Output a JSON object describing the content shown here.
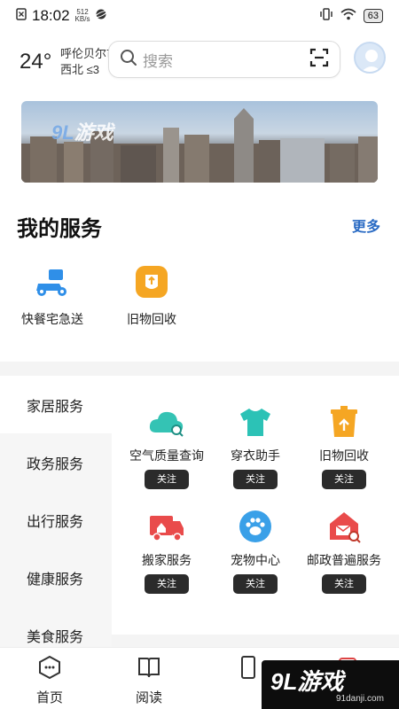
{
  "status_bar": {
    "time": "18:02",
    "net_speed_value": "512",
    "net_speed_unit": "KB/s",
    "battery": "63"
  },
  "header": {
    "temperature": "24°",
    "city": "呼伦贝尔市",
    "wind": "西北  ≤3"
  },
  "search": {
    "placeholder": "搜索"
  },
  "banner": {
    "logo_num": "9L",
    "logo_text": "游戏"
  },
  "my_services": {
    "title": "我的服务",
    "more": "更多",
    "items": [
      {
        "label": "快餐宅急送",
        "icon": "delivery-scooter-icon",
        "color": "#2f8fe8"
      },
      {
        "label": "旧物回收",
        "icon": "recycle-badge-icon",
        "color": "#f5a623"
      }
    ]
  },
  "categories": {
    "sidebar": [
      {
        "label": "家居服务"
      },
      {
        "label": "政务服务"
      },
      {
        "label": "出行服务"
      },
      {
        "label": "健康服务"
      },
      {
        "label": "美食服务"
      }
    ],
    "follow_label": "关注",
    "items": [
      {
        "label": "空气质量查询",
        "icon": "cloud-search-icon",
        "color": "#34c3b4"
      },
      {
        "label": "穿衣助手",
        "icon": "tshirt-icon",
        "color": "#2cc2b6"
      },
      {
        "label": "旧物回收",
        "icon": "recycle-bin-icon",
        "color": "#f5a623"
      },
      {
        "label": "搬家服务",
        "icon": "moving-truck-icon",
        "color": "#e94b4b"
      },
      {
        "label": "宠物中心",
        "icon": "paw-icon",
        "color": "#3aa0e8"
      },
      {
        "label": "邮政普遍服务",
        "icon": "mail-house-icon",
        "color": "#e94b4b"
      }
    ]
  },
  "tabbar": {
    "items": [
      {
        "label": "首页",
        "icon": "home-hex-icon"
      },
      {
        "label": "阅读",
        "icon": "book-icon"
      }
    ]
  },
  "watermark": {
    "main": "9L游戏",
    "sub": "91danji.com"
  }
}
